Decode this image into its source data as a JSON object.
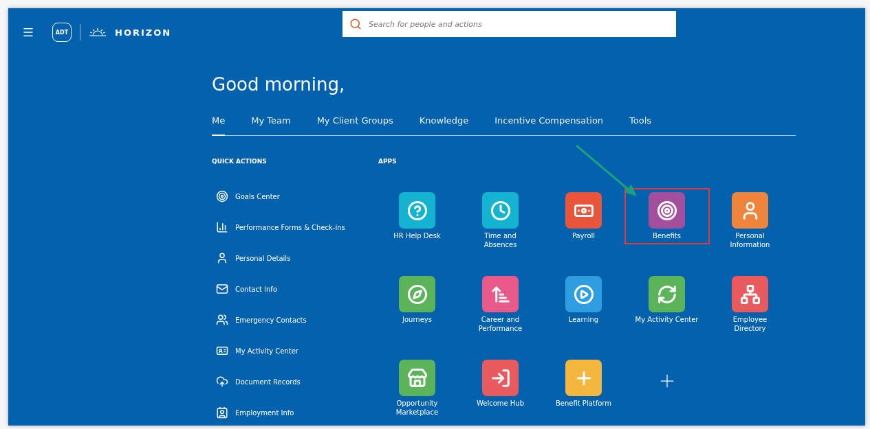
{
  "header": {
    "logo_text": "ADT",
    "brand": "HORIZON"
  },
  "search": {
    "placeholder": "Search for people and actions"
  },
  "greeting": "Good morning,",
  "tabs": [
    {
      "label": "Me",
      "selected": true
    },
    {
      "label": "My Team",
      "selected": false
    },
    {
      "label": "My Client Groups",
      "selected": false
    },
    {
      "label": "Knowledge",
      "selected": false
    },
    {
      "label": "Incentive Compensation",
      "selected": false
    },
    {
      "label": "Tools",
      "selected": false
    }
  ],
  "quick_actions": {
    "title": "QUICK ACTIONS",
    "items": [
      {
        "label": "Goals Center"
      },
      {
        "label": "Performance Forms & Check-ins"
      },
      {
        "label": "Personal Details"
      },
      {
        "label": "Contact Info"
      },
      {
        "label": "Emergency Contacts"
      },
      {
        "label": "My Activity Center"
      },
      {
        "label": "Document Records"
      },
      {
        "label": "Employment Info"
      }
    ]
  },
  "apps": {
    "title": "APPS",
    "items": [
      {
        "kind": "app",
        "label": "HR Help Desk",
        "color": "#13b3d1",
        "highlighted": false
      },
      {
        "kind": "app",
        "label": "Time and Absences",
        "color": "#13b3d1",
        "highlighted": false
      },
      {
        "kind": "app",
        "label": "Payroll",
        "color": "#e9553a",
        "highlighted": false
      },
      {
        "kind": "app",
        "label": "Benefits",
        "color": "#a44f9d",
        "highlighted": true
      },
      {
        "kind": "app",
        "label": "Personal Information",
        "color": "#ef853c",
        "highlighted": false
      },
      {
        "kind": "app",
        "label": "Journeys",
        "color": "#5cb45a",
        "highlighted": false
      },
      {
        "kind": "app",
        "label": "Career and Performance",
        "color": "#e95a8a",
        "highlighted": false
      },
      {
        "kind": "app",
        "label": "Learning",
        "color": "#2f9ee0",
        "highlighted": false
      },
      {
        "kind": "app",
        "label": "My Activity Center",
        "color": "#5cb45a",
        "highlighted": false
      },
      {
        "kind": "app",
        "label": "Employee Directory",
        "color": "#e85a5e",
        "highlighted": false
      },
      {
        "kind": "app",
        "label": "Opportunity Marketplace",
        "color": "#5cb45a",
        "highlighted": false
      },
      {
        "kind": "app",
        "label": "Welcome Hub",
        "color": "#e85a5e",
        "highlighted": false
      },
      {
        "kind": "app",
        "label": "Benefit Platform",
        "color": "#f5b63e",
        "highlighted": false
      },
      {
        "kind": "add"
      }
    ]
  }
}
